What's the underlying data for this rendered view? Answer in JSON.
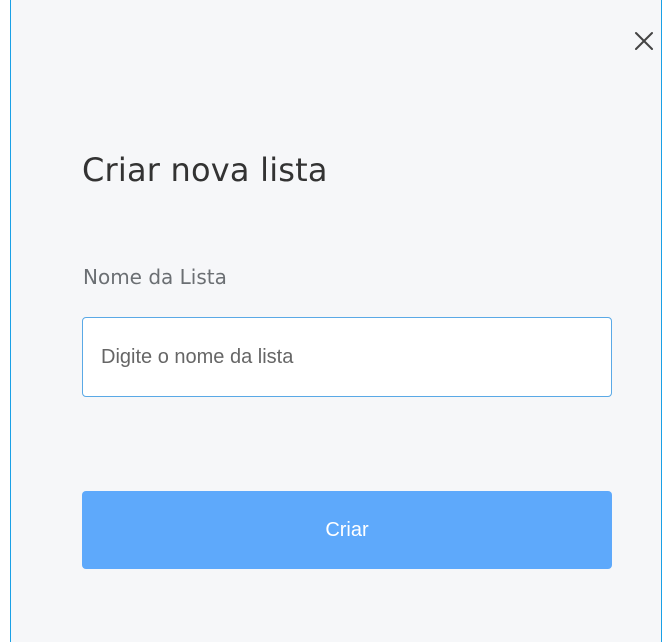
{
  "dialog": {
    "title": "Criar nova lista",
    "close_icon": "close-icon",
    "field": {
      "label": "Nome da Lista",
      "value": "",
      "placeholder": "Digite o nome da lista"
    },
    "submit_label": "Criar"
  },
  "colors": {
    "modal_background": "#f6f7f9",
    "border_accent": "#1aa0e6",
    "input_border": "#5aa9e6",
    "button_background": "#5ea9fb",
    "button_text": "#ffffff",
    "title_text": "#333333",
    "label_text": "#6b6f73"
  }
}
